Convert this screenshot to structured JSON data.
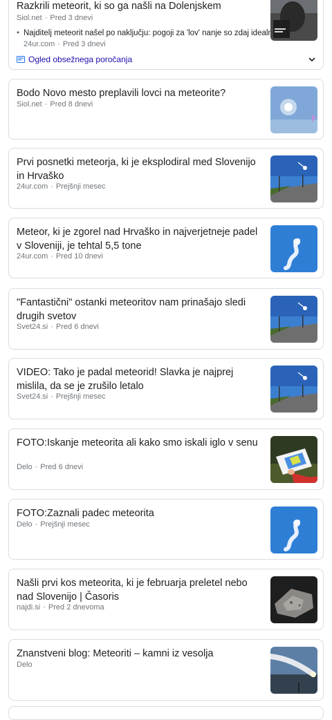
{
  "featured": {
    "title": "Razkrili meteorit, ki so ga našli na Dolenjskem",
    "source": "Siol.net",
    "time": "Pred 3 dnevi",
    "sub_title": "Najditelj meteorit našel po naključju: pogoji za 'lov' nanje so zdaj idealni",
    "sub_source": "24ur.com",
    "sub_time": "Pred 3 dnevi",
    "coverage_label": "Ogled obsežnega poročanja",
    "thumb_icon": "meteorite-photo"
  },
  "articles": [
    {
      "title": "Bodo Novo mesto preplavili lovci na meteorite?",
      "source": "Siol.net",
      "time": "Pred 8 dnevi",
      "thumb": "sun-sky-thumbnail"
    },
    {
      "title": "Prvi posnetki meteorja, ki je eksplodiral med Slovenijo in Hrvaško",
      "source": "24ur.com",
      "time": "Prejšnji mesec",
      "thumb": "road-meteor-thumbnail"
    },
    {
      "title": "Meteor, ki je zgorel nad Hrvaško in najverjetneje padel v Sloveniji, je tehtal 5,5 tone",
      "source": "24ur.com",
      "time": "Pred 10 dnevi",
      "thumb": "smoke-trail-thumbnail"
    },
    {
      "title": "\"Fantastični\" ostanki meteoritov nam prinašajo sledi drugih svetov",
      "source": "Svet24.si",
      "time": "Pred 6 dnevi",
      "thumb": "road-meteor-thumbnail"
    },
    {
      "title": "VIDEO: Tako je padal meteorid! Slavka je najprej mislila, da se je zrušilo letalo",
      "source": "Svet24.si",
      "time": "Prejšnji mesec",
      "thumb": "road-meteor-thumbnail"
    },
    {
      "title": "FOTO:Iskanje meteorita ali kako smo iskali iglo v senu",
      "source": "Delo",
      "time": "Pred 6 dnevi",
      "thumb": "map-in-hand-thumbnail"
    },
    {
      "title": "FOTO:Zaznali padec meteorita",
      "source": "Delo",
      "time": "Prejšnji mesec",
      "thumb": "smoke-trail-thumbnail"
    },
    {
      "title": "Našli prvi kos meteorita, ki je februarja preletel nebo nad Slovenijo | Časoris",
      "source": "najdi.si",
      "time": "Pred 2 dnevoma",
      "thumb": "rock-thumbnail"
    },
    {
      "title": "Znanstveni blog: Meteoriti – kamni iz vesolja",
      "source": "Delo",
      "time": "",
      "thumb": "fireball-trail-thumbnail"
    }
  ],
  "colors": {
    "link": "#1a0dab",
    "border": "#dadce0",
    "meta": "#70757a"
  }
}
